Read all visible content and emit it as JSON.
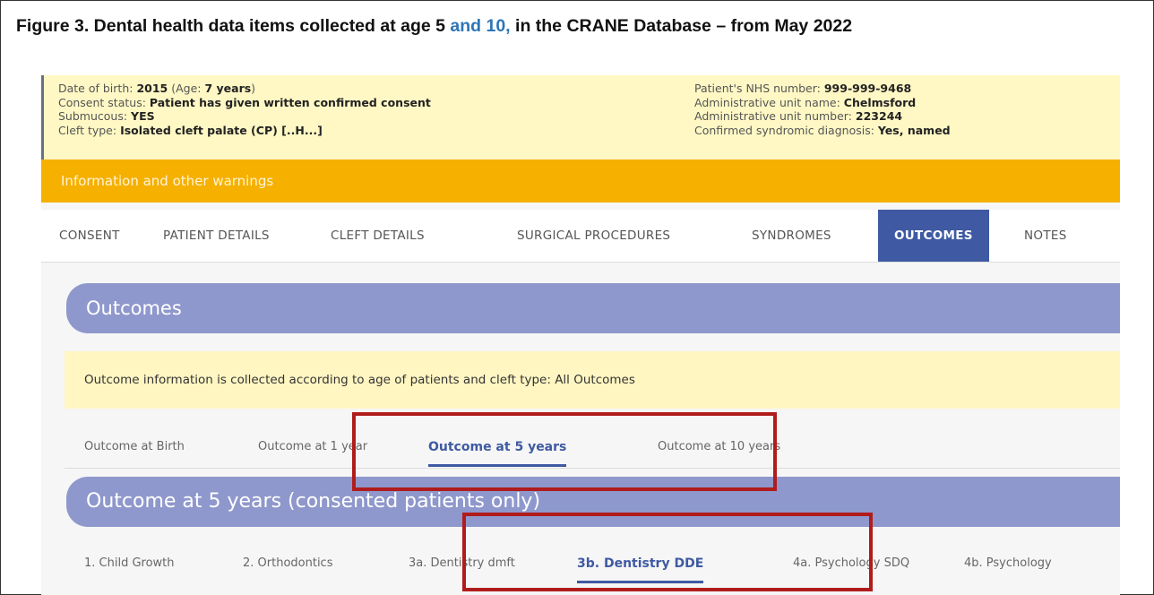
{
  "figure": {
    "title_part1": "Figure 3. Dental health data items collected at age 5 ",
    "title_part2": "and 10,",
    "title_part3": " in the CRANE Database – from May 2022"
  },
  "patient": {
    "dob_label": "Date of birth: ",
    "dob_value": "2015",
    "age_prefix": " (Age: ",
    "age_value": "7 years",
    "age_suffix": ")",
    "consent_label": "Consent status: ",
    "consent_value": "Patient has given written confirmed consent",
    "submucous_label": "Submucous: ",
    "submucous_value": "YES",
    "cleft_label": "Cleft type: ",
    "cleft_value": "Isolated cleft palate (CP) [..H...]",
    "nhs_label": "Patient's NHS number: ",
    "nhs_value": "999-999-9468",
    "unit_name_label": "Administrative unit name: ",
    "unit_name_value": "Chelmsford",
    "unit_number_label": "Administrative unit number: ",
    "unit_number_value": "223244",
    "syndromic_label": "Confirmed syndromic diagnosis: ",
    "syndromic_value": "Yes, named"
  },
  "warnings": {
    "label": "Information and other warnings"
  },
  "nav": {
    "consent": "CONSENT",
    "patient_details": "PATIENT DETAILS",
    "cleft_details": "CLEFT DETAILS",
    "surgical": "SURGICAL PROCEDURES",
    "syndromes": "SYNDROMES",
    "outcomes": "OUTCOMES",
    "notes": "NOTES"
  },
  "outcomes": {
    "header": "Outcomes",
    "info": "Outcome information is collected according to age of patients and cleft type: All Outcomes",
    "age_tabs": {
      "birth": "Outcome at Birth",
      "one_year": "Outcome at 1 year",
      "five_years": "Outcome at 5 years",
      "ten_years": "Outcome at 10 years"
    },
    "section_header": "Outcome at 5 years (consented patients only)",
    "section_tabs": {
      "growth": "1. Child Growth",
      "ortho": "2. Orthodontics",
      "dmft": "3a. Dentistry dmft",
      "dde": "3b. Dentistry DDE",
      "sdq": "4a. Psychology SDQ",
      "psych": "4b. Psychology"
    }
  },
  "colors": {
    "nav_active": "#3f5aa3",
    "band": "#8f98cc",
    "warning": "#f5b000",
    "highlight_box": "#b01c1c",
    "title_highlight": "#2e75b6"
  }
}
